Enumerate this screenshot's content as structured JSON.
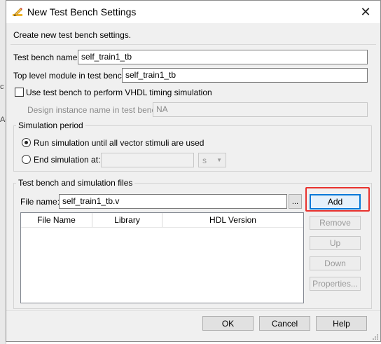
{
  "background": {
    "fragments": [
      "c",
      "Ac"
    ]
  },
  "dialog": {
    "title": "New Test Bench Settings",
    "intro": "Create new test bench settings.",
    "test_bench_name_label": "Test bench name:",
    "test_bench_name_value": "self_train1_tb",
    "top_level_label": "Top level module in test bench:",
    "top_level_value": "self_train1_tb",
    "vhdl_timing_label": "Use test bench to perform VHDL timing simulation",
    "design_instance_label": "Design instance name in test bench:",
    "design_instance_value": "NA",
    "sim_period": {
      "title": "Simulation period",
      "run_option": "Run simulation until all vector stimuli are used",
      "end_option": "End simulation at:",
      "end_value": "",
      "unit": "s"
    },
    "files": {
      "title": "Test bench and simulation files",
      "file_name_label": "File name:",
      "file_name_value": "self_train1_tb.v",
      "browse_label": "...",
      "columns": [
        "File Name",
        "Library",
        "HDL Version"
      ],
      "rows": []
    },
    "side_buttons": {
      "add": "Add",
      "remove": "Remove",
      "up": "Up",
      "down": "Down",
      "properties": "Properties..."
    },
    "footer": {
      "ok": "OK",
      "cancel": "Cancel",
      "help": "Help"
    },
    "highlight_color": "#e8322e",
    "accent_color": "#0078d7"
  }
}
